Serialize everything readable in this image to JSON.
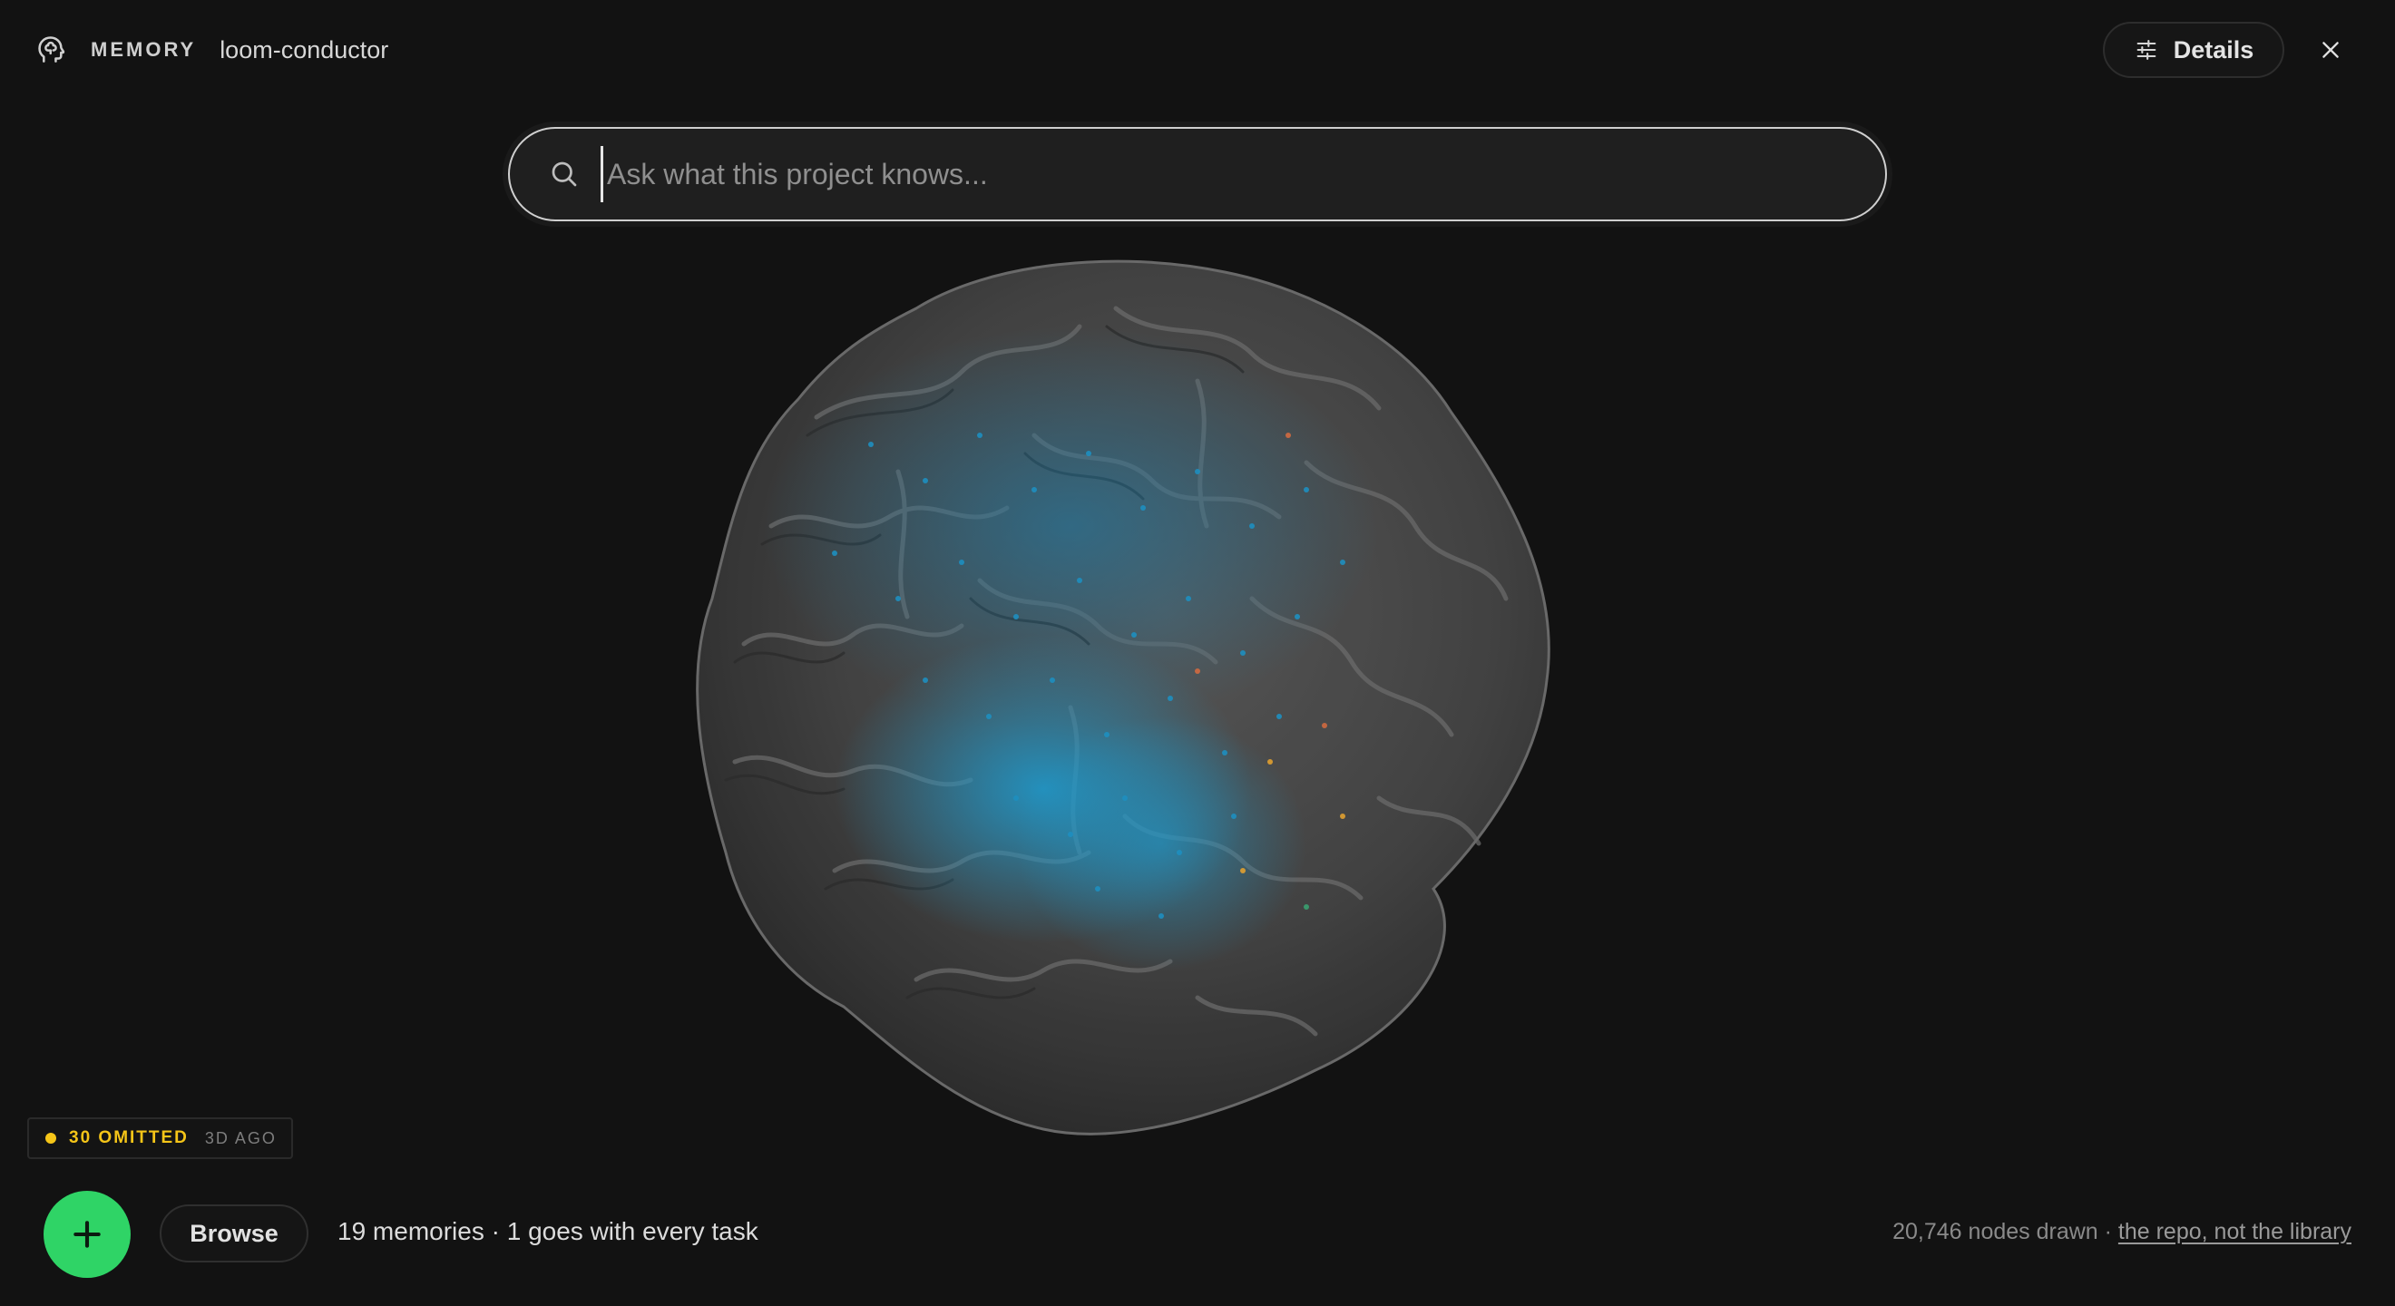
{
  "header": {
    "logo_icon": "brain-head-icon",
    "brand": "MEMORY",
    "project": "loom-conductor",
    "details_label": "Details",
    "details_icon": "sliders-icon",
    "close_icon": "close-icon"
  },
  "search": {
    "placeholder": "Ask what this project knows...",
    "value": "",
    "icon": "search-icon"
  },
  "visualization": {
    "icon": "brain-visualization",
    "node_color": "#1e8fc0",
    "accent_colors": [
      "#e0a030",
      "#d06a40",
      "#3aa070"
    ]
  },
  "status": {
    "omitted": "30 OMITTED",
    "when": "3D AGO",
    "dot_color": "#f5c518"
  },
  "footer": {
    "add_icon": "plus-icon",
    "add_color": "#2fd466",
    "browse_label": "Browse",
    "summary": "19 memories · 1 goes with every task",
    "nodes_text": "20,746 nodes drawn · ",
    "scope_link": "the repo, not the library"
  }
}
